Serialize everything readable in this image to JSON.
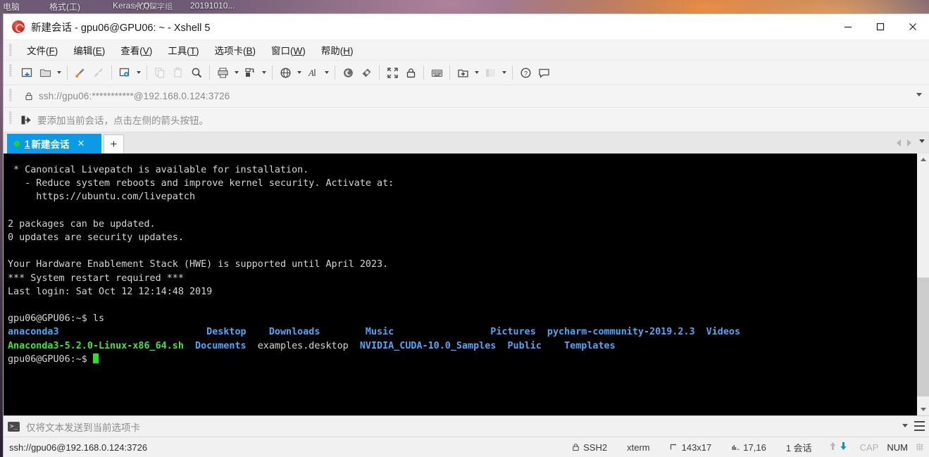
{
  "desktop": {
    "icons": [
      "电脑",
      "格式(工)",
      "Keras-YOL...",
      "20191010..."
    ],
    "sub_label": "水刀深字组"
  },
  "window": {
    "title": "新建会话 - gpu06@GPU06: ~ - Xshell 5",
    "logo_icon": "xshell-logo-icon",
    "controls": {
      "minimize": "minimize-icon",
      "maximize": "maximize-icon",
      "close": "close-icon"
    }
  },
  "menubar": {
    "items": [
      {
        "label": "文件",
        "accel": "F"
      },
      {
        "label": "编辑",
        "accel": "E"
      },
      {
        "label": "查看",
        "accel": "V"
      },
      {
        "label": "工具",
        "accel": "T"
      },
      {
        "label": "选项卡",
        "accel": "B"
      },
      {
        "label": "窗口",
        "accel": "W"
      },
      {
        "label": "帮助",
        "accel": "H"
      }
    ]
  },
  "toolbar": {
    "items": [
      "new-session-icon",
      "open-folder-icon",
      "open-folder-caret",
      "sep",
      "connect-icon",
      "disconnect-icon",
      "sep",
      "session-properties-icon",
      "session-properties-caret",
      "sep",
      "copy-icon",
      "paste-icon",
      "find-icon",
      "sep",
      "print-icon",
      "print-caret",
      "transfer-file-icon",
      "transfer-file-caret",
      "sep",
      "browser-icon",
      "browser-caret",
      "font-icon",
      "font-caret",
      "sep",
      "xshell-icon",
      "xftp-icon",
      "sep",
      "fullscreen-icon",
      "lock-icon",
      "sep",
      "compose-pane-icon",
      "sep",
      "add-to-folder-icon",
      "add-to-folder-caret",
      "layout-icon",
      "layout-caret",
      "sep",
      "help-icon",
      "feedback-icon"
    ]
  },
  "addressbar": {
    "lock_icon": "lock-icon",
    "value": "ssh://gpu06:***********@192.168.0.124:3726",
    "dropdown_icon": "chevron-down-icon"
  },
  "noticebar": {
    "icon": "add-session-icon",
    "text": "要添加当前会话，点击左侧的箭头按钮。"
  },
  "tabs": {
    "active": {
      "status_dot": "connected-dot",
      "number": "1",
      "label": "新建会话",
      "close_icon": "close-icon"
    },
    "new_tab_label": "+",
    "scroll_left_icon": "arrow-left-icon",
    "scroll_right_icon": "arrow-right-icon",
    "tab_menu_icon": "chevron-down-icon"
  },
  "terminal": {
    "lines": [
      [
        {
          "t": " * Canonical Livepatch is available for installation.",
          "c": "white"
        }
      ],
      [
        {
          "t": "   - Reduce system reboots and improve kernel security. Activate at:",
          "c": "white"
        }
      ],
      [
        {
          "t": "     https://ubuntu.com/livepatch",
          "c": "white"
        }
      ],
      [
        {
          "t": "",
          "c": "white"
        }
      ],
      [
        {
          "t": "2 packages can be updated.",
          "c": "white"
        }
      ],
      [
        {
          "t": "0 updates are security updates.",
          "c": "white"
        }
      ],
      [
        {
          "t": "",
          "c": "white"
        }
      ],
      [
        {
          "t": "Your Hardware Enablement Stack (HWE) is supported until April 2023.",
          "c": "white"
        }
      ],
      [
        {
          "t": "*** System restart required ***",
          "c": "white"
        }
      ],
      [
        {
          "t": "Last login: Sat Oct 12 12:14:48 2019",
          "c": "white"
        }
      ],
      [
        {
          "t": "",
          "c": "white"
        }
      ],
      [
        {
          "t": "gpu06@GPU06:~$ ls",
          "c": "white"
        }
      ],
      [
        {
          "t": "anaconda3",
          "c": "blue"
        },
        {
          "t": "                          ",
          "c": "white"
        },
        {
          "t": "Desktop",
          "c": "blue"
        },
        {
          "t": "    ",
          "c": "white"
        },
        {
          "t": "Downloads",
          "c": "blue"
        },
        {
          "t": "        ",
          "c": "white"
        },
        {
          "t": "Music",
          "c": "blue"
        },
        {
          "t": "                 ",
          "c": "white"
        },
        {
          "t": "Pictures",
          "c": "blue"
        },
        {
          "t": "  ",
          "c": "white"
        },
        {
          "t": "pycharm-community-2019.2.3",
          "c": "blue"
        },
        {
          "t": "  ",
          "c": "white"
        },
        {
          "t": "Videos",
          "c": "blue"
        }
      ],
      [
        {
          "t": "Anaconda3-5.2.0-Linux-x86_64.sh",
          "c": "green"
        },
        {
          "t": "  ",
          "c": "white"
        },
        {
          "t": "Documents",
          "c": "blue"
        },
        {
          "t": "  examples.desktop  ",
          "c": "white"
        },
        {
          "t": "NVIDIA_CUDA-10.0_Samples",
          "c": "blue"
        },
        {
          "t": "  ",
          "c": "white"
        },
        {
          "t": "Public",
          "c": "blue"
        },
        {
          "t": "    ",
          "c": "white"
        },
        {
          "t": "Templates",
          "c": "blue"
        }
      ],
      [
        {
          "t": "gpu06@GPU06:~$ ",
          "c": "white"
        },
        {
          "t": "CURSOR",
          "c": "cursor"
        }
      ]
    ],
    "scrollbar": {
      "up_icon": "scroll-up-icon",
      "down_icon": "scroll-down-icon"
    }
  },
  "sendbar": {
    "icon": "terminal-prompt-icon",
    "text": "仅将文本发送到当前选项卡",
    "dropdown_icon": "chevron-down-icon",
    "menu_icon": "hamburger-menu-icon"
  },
  "statusbar": {
    "url": "ssh://gpu06@192.168.0.124:3726",
    "protocol_icon": "lock-icon",
    "protocol": "SSH2",
    "terminal_type": "xterm",
    "size_icon": "size-icon",
    "size": "143x17",
    "cursor_icon": "cursor-pos-icon",
    "cursor_pos": "17,16",
    "sessions": "1 会话",
    "upload_icon": "arrow-up-icon",
    "download_icon": "arrow-down-icon",
    "cap": "CAP",
    "num": "NUM"
  },
  "colors": {
    "accent": "#0a9ae6",
    "tab_dot": "#27d427",
    "terminal_blue": "#4fa7f7",
    "terminal_green": "#3ee63e",
    "terminal_bg": "#000000"
  }
}
